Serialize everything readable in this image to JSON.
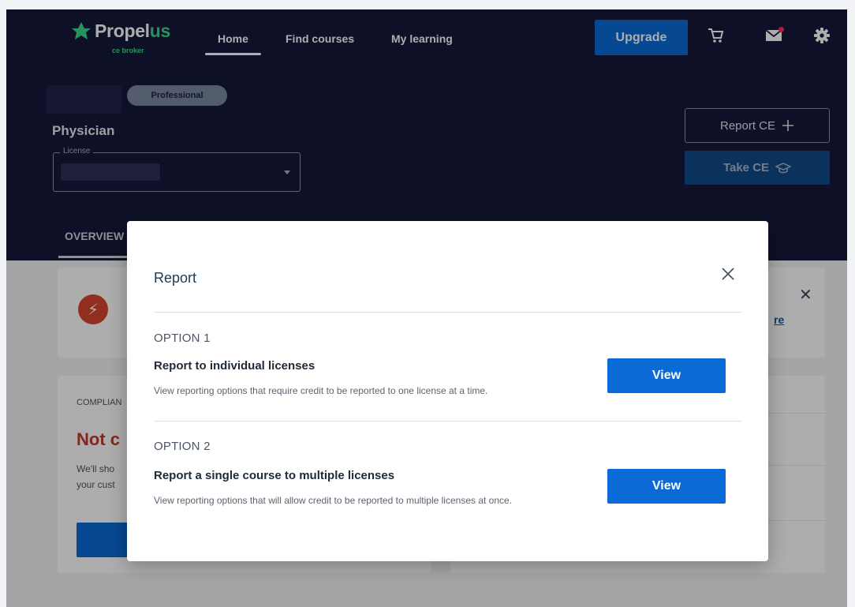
{
  "nav": {
    "brand": "Propel",
    "brand_accent": "us",
    "brand_sub": "ce broker",
    "links": [
      "Home",
      "Find courses",
      "My learning"
    ],
    "upgrade_label": "Upgrade",
    "icons": [
      "cart-icon",
      "mail-icon",
      "gear-icon"
    ]
  },
  "header": {
    "badge": "Professional",
    "profession": "Physician",
    "license_label": "License",
    "report_ce_label": "Report CE",
    "take_ce_label": "Take CE",
    "tab_overview": "OVERVIEW"
  },
  "background": {
    "alert_link": "re",
    "compliance_label": "COMPLIAN",
    "compliance_status": "Not c",
    "compliance_text_1": "We'll sho",
    "compliance_text_2": "your cust"
  },
  "modal": {
    "title": "Report",
    "options": [
      {
        "label": "OPTION 1",
        "title": "Report to individual licenses",
        "description": "View reporting options that require credit to be reported to one license at a time.",
        "button": "View"
      },
      {
        "label": "OPTION 2",
        "title": "Report a single course to multiple licenses",
        "description": "View reporting options that will allow credit to be reported to multiple licenses at once.",
        "button": "View"
      }
    ]
  },
  "colors": {
    "navy": "#16193a",
    "primary_blue": "#0a6ad6",
    "brand_green": "#39d98a",
    "alert_red": "#d7442e"
  }
}
